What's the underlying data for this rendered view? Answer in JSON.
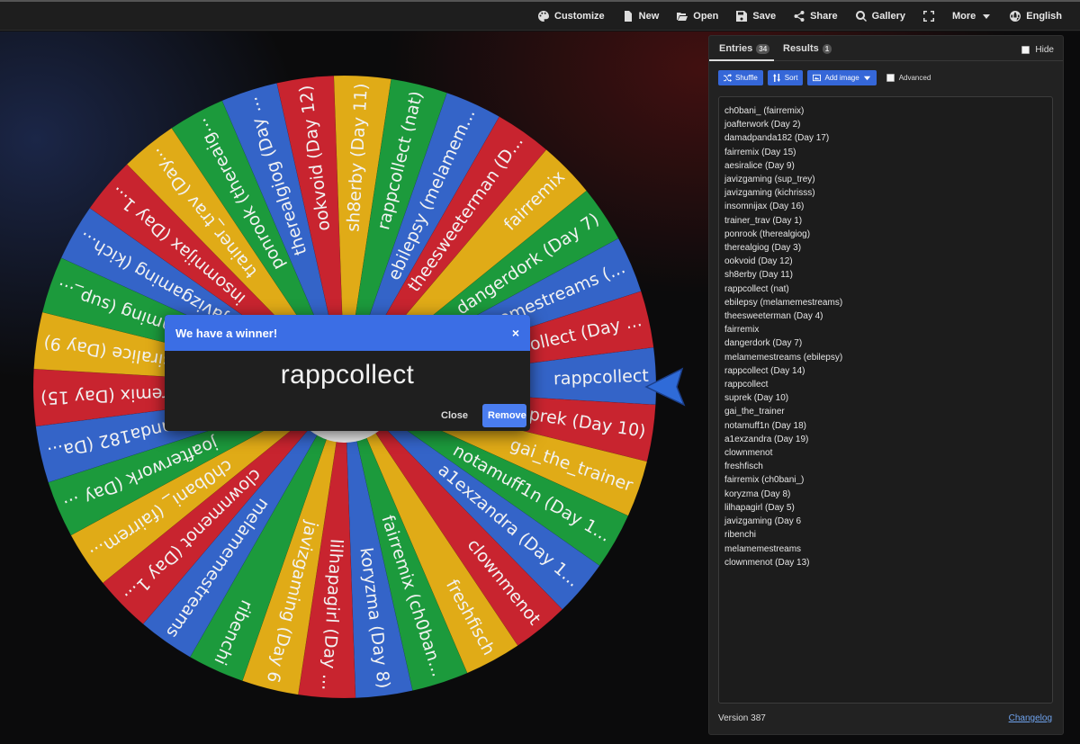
{
  "toolbar": {
    "items": [
      {
        "label": "Customize",
        "icon": "palette-icon"
      },
      {
        "label": "New",
        "icon": "file-icon"
      },
      {
        "label": "Open",
        "icon": "folder-open-icon"
      },
      {
        "label": "Save",
        "icon": "save-icon"
      },
      {
        "label": "Share",
        "icon": "share-icon"
      },
      {
        "label": "Gallery",
        "icon": "search-icon"
      },
      {
        "label": "",
        "icon": "fullscreen-icon"
      },
      {
        "label": "More",
        "icon": "chevron-down-icon"
      },
      {
        "label": "English",
        "icon": "globe-icon"
      }
    ]
  },
  "wheel": {
    "colors": [
      "#3464c8",
      "#c8242f",
      "#e0ab17",
      "#1c9a3c"
    ],
    "pointer_color": "#2f6bd8",
    "segments": [
      "rappcollect",
      "suprek (Day 10)",
      "gai_the_trainer",
      "notamuff1n (Day 1...",
      "a1exzandra (Day 1...",
      "clownmenot",
      "freshfisch",
      "fairremix (ch0ban...",
      "koryzma (Day 8)",
      "lilhapagirl (Day ...",
      "javizgaming (Day 6",
      "ribenchi",
      "melamemestreams",
      "clownmenot (Day 1...",
      "ch0bani_ (fairrem...",
      "joafterwork (Day ...",
      "damadpanda182 (Da...",
      "fairremix (Day 15)",
      "aesiralice (Day 9)",
      "javizgaming (sup_...",
      "javizgaming (kich...",
      "insomnijax (Day 1...",
      "trainer_trav (Day...",
      "ponrook (thereaig...",
      "therealgiog (Day ...",
      "ookvoid (Day 12)",
      "sh8erby (Day 11)",
      "rappcollect (nat)",
      "ebilepsy (melamem...",
      "theesweeterman (D...",
      "fairremix",
      "dangerdork (Day 7)",
      "melamemestreams (...",
      "rappcollect (Day ..."
    ]
  },
  "modal": {
    "title": "We have a winner!",
    "close_x": "×",
    "winner": "rappcollect",
    "close_label": "Close",
    "remove_label": "Remove"
  },
  "panel": {
    "entries_tab": "Entries",
    "entries_count": "34",
    "results_tab": "Results",
    "results_count": "1",
    "hide_label": "Hide",
    "shuffle_label": "Shuffle",
    "sort_label": "Sort",
    "add_image_label": "Add image",
    "advanced_label": "Advanced",
    "version": "Version 387",
    "changelog": "Changelog",
    "entries": [
      "ch0bani_ (fairremix)",
      "joafterwork (Day 2)",
      "damadpanda182 (Day 17)",
      "fairremix (Day 15)",
      "aesiralice (Day 9)",
      "javizgaming (sup_trey)",
      "javizgaming (kichrisss)",
      "insomnijax (Day 16)",
      "trainer_trav (Day 1)",
      "ponrook (therealgiog)",
      "therealgiog (Day 3)",
      "ookvoid (Day 12)",
      "sh8erby (Day 11)",
      "rappcollect (nat)",
      "ebilepsy (melamemestreams)",
      "theesweeterman (Day 4)",
      "fairremix",
      "dangerdork (Day 7)",
      "melamemestreams (ebilepsy)",
      "rappcollect (Day 14)",
      "rappcollect",
      "suprek (Day 10)",
      "gai_the_trainer",
      "notamuff1n (Day 18)",
      "a1exzandra (Day 19)",
      "clownmenot",
      "freshfisch",
      "fairremix (ch0bani_)",
      "koryzma (Day 8)",
      "lilhapagirl (Day 5)",
      "javizgaming (Day 6",
      "ribenchi",
      "melamemestreams",
      "clownmenot (Day 13)"
    ]
  }
}
